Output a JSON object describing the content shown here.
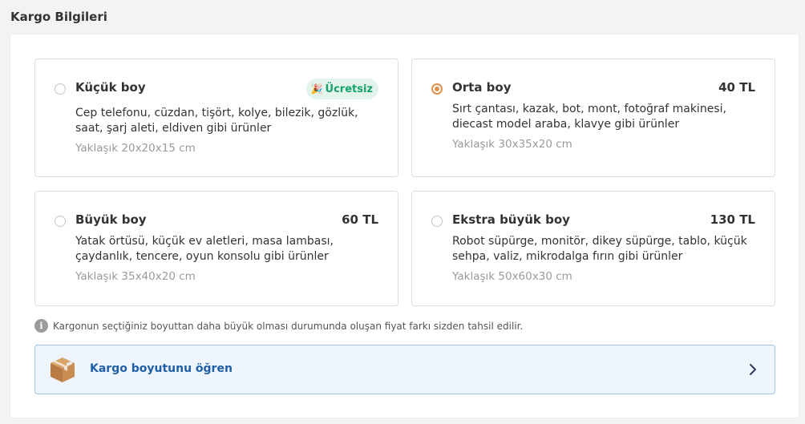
{
  "section": {
    "title": "Kargo Bilgileri"
  },
  "options": [
    {
      "title": "Küçük boy",
      "badge": "Ücretsiz",
      "description": "Cep telefonu, cüzdan, tişört, kolye, bilezik, gözlük, saat, şarj aleti, eldiven gibi ürünler",
      "size": "Yaklaşık 20x20x15 cm",
      "selected": false
    },
    {
      "title": "Orta boy",
      "price": "40 TL",
      "description": "Sırt çantası, kazak, bot, mont, fotoğraf makinesi, diecast model araba, klavye gibi ürünler",
      "size": "Yaklaşık 30x35x20 cm",
      "selected": true
    },
    {
      "title": "Büyük boy",
      "price": "60 TL",
      "description": "Yatak örtüsü, küçük ev aletleri, masa lambası, çaydanlık, tencere, oyun konsolu gibi ürünler",
      "size": "Yaklaşık 35x40x20 cm",
      "selected": false
    },
    {
      "title": "Ekstra büyük boy",
      "price": "130 TL",
      "description": "Robot süpürge, monitör, dikey süpürge, tablo, küçük sehpa, valiz, mikrodalga fırın gibi ürünler",
      "size": "Yaklaşık 50x60x30 cm",
      "selected": false
    }
  ],
  "note": {
    "icon": "info-icon",
    "text": "Kargonun seçtiğiniz boyuttan daha büyük olması durumunda oluşan fiyat farkı sizden tahsil edilir."
  },
  "size_link": {
    "icon": "box-icon",
    "label": "Kargo boyutunu öğren"
  },
  "colors": {
    "accent": "#e2904a",
    "badge_text": "#16a26a",
    "badge_bg": "#e3f4ec",
    "link_text": "#1f5fa8",
    "link_bg": "#eef5fd",
    "link_border": "#9fc4ea"
  }
}
